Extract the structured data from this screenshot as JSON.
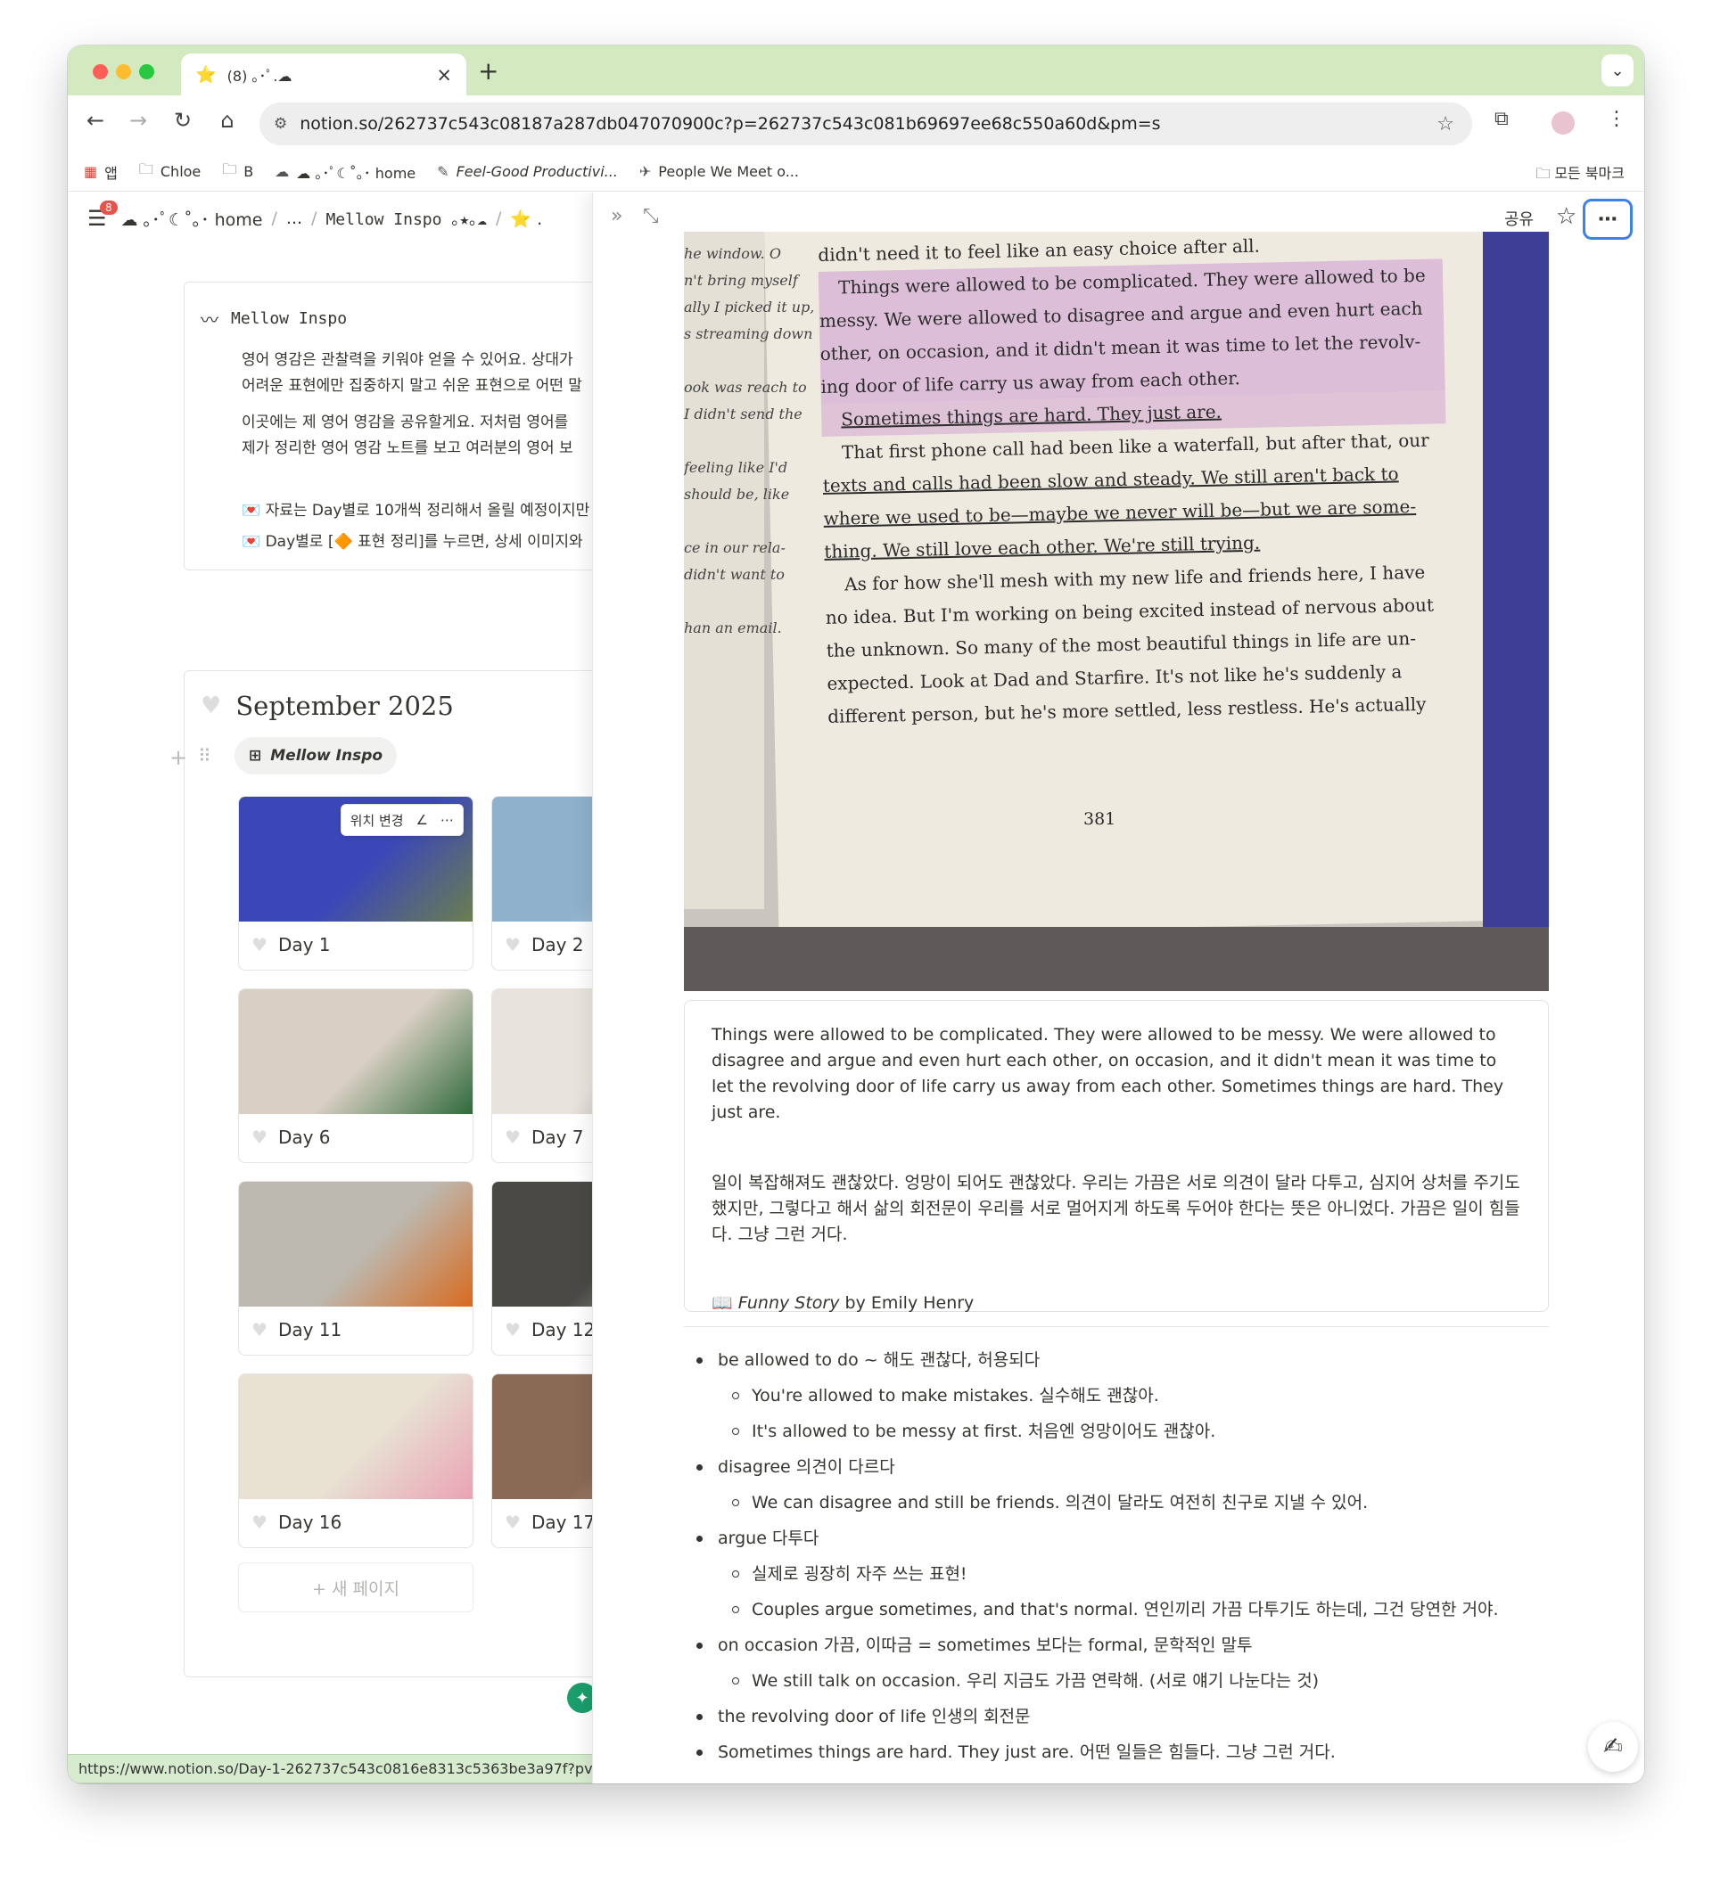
{
  "browser": {
    "tab": {
      "title": "(8) ｡･ﾟ.☁",
      "favicon": "⭐"
    },
    "url": "notion.so/262737c543c08187a287db047070900c?p=262737c543c081b69697ee68c550a60d&pm=s",
    "bookmarks": [
      {
        "icon": "apps-icon",
        "glyph": "▦",
        "label": "앱"
      },
      {
        "icon": "folder-icon",
        "glyph": "🗀",
        "label": "Chloe"
      },
      {
        "icon": "folder-icon",
        "glyph": "🗀",
        "label": "B"
      },
      {
        "icon": "cloud-icon",
        "glyph": "☁",
        "label": "☁ ｡･ﾟ☾˚｡･ home"
      },
      {
        "icon": "page-icon",
        "glyph": "✎",
        "label": "Feel-Good Productivi..."
      },
      {
        "icon": "plane-icon",
        "glyph": "✈",
        "label": "People We Meet o..."
      }
    ],
    "bookmarks_right": "모든 북마크",
    "status_url": "https://www.notion.so/Day-1-262737c543c0816e8313c5363be3a97f?pvs=25"
  },
  "notion": {
    "notification_count": "8",
    "breadcrumb": [
      "☁ ｡･ﾟ☾˚｡･ home",
      "...",
      "Mellow Inspo ｡★｡☁",
      "⭐ ."
    ],
    "callout": {
      "title": "Mellow Inspo",
      "p1_line1": "영어 영감은 관찰력을 키워야 얻을 수 있어요. 상대가",
      "p1_line2": "어려운 표현에만 집중하지 말고 쉬운 표현으로 어떤 말",
      "p2_line1": "이곳에는 제 영어 영감을 공유할게요. 저처럼 영어를",
      "p2_line2": "제가 정리한 영어 영감 노트를 보고 여러분의 영어 보",
      "bullet1": "💌 자료는 Day별로 10개씩 정리해서 올릴 예정이지만",
      "bullet2": "💌 Day별로 [🔶 표현 정리]를 누르면, 상세 이미지와"
    },
    "gallery": {
      "title": "September 2025",
      "view_label": "Mellow Inspo",
      "hover_tools_label": "위치 변경",
      "new_page": "+ 새 페이지",
      "cards": [
        {
          "label": "Day 1",
          "c1": "#3b47b8",
          "c2": "#6a7f4e"
        },
        {
          "label": "Day 2",
          "c1": "#8fb1cc",
          "c2": "#c9dbe8"
        },
        {
          "label": "Day 6",
          "c1": "#d9cfc3",
          "c2": "#2f6a3a"
        },
        {
          "label": "Day 7",
          "c1": "#e8e4dd",
          "c2": "#9a9590"
        },
        {
          "label": "Day 11",
          "c1": "#bdb9b0",
          "c2": "#d86a1f"
        },
        {
          "label": "Day 12",
          "c1": "#4a4946",
          "c2": "#e8e6e0"
        },
        {
          "label": "Day 16",
          "c1": "#e9e2d3",
          "c2": "#e9a3b5"
        },
        {
          "label": "Day 17",
          "c1": "#8a6a55",
          "c2": "#d9c3ad"
        }
      ]
    }
  },
  "peek": {
    "share_label": "공유",
    "photo": {
      "lines": [
        "didn't need it to feel like an easy choice after all.",
        "Things were allowed to be complicated. They were allowed to be",
        "messy. We were allowed to disagree and argue and even hurt each",
        "other, on occasion, and it didn't mean it was time to let the revolv-",
        "ing door of life carry us away from each other.",
        "Sometimes things are hard. They just are.",
        "That first phone call had been like a waterfall, but after that, our",
        "texts and calls had been slow and steady. We still aren't back to",
        "where we used to be—maybe we never will be—but we are some-",
        "thing. We still love each other. We're still trying.",
        "As for how she'll mesh with my new life and friends here, I have",
        "no idea. But I'm working on being excited instead of nervous about",
        "the unknown. So many of the most beautiful things in life are un-",
        "expected. Look at Dad and Starfire. It's not like he's suddenly a",
        "different person, but he's more settled, less restless. He's actually"
      ],
      "page_number": "381",
      "left_margin_lines": [
        "he window. O",
        "n't bring myself",
        "ally I picked it up,",
        "s streaming down",
        "",
        "ook was reach to",
        "I didn't send the",
        "",
        "feeling like I'd",
        "should be, like",
        "",
        "ce in our rela-",
        "didn't want to",
        "",
        "han an email."
      ]
    },
    "quote": {
      "english": "Things were allowed to be complicated. They were allowed to be messy. We were allowed to disagree and argue and even hurt each other, on occasion, and it didn't mean it was time to let the revolving door of life carry us away from each other. Sometimes things are hard. They just are.",
      "korean": "일이 복잡해져도 괜찮았다. 엉망이 되어도 괜찮았다. 우리는 가끔은 서로 의견이 달라 다투고, 심지어 상처를 주기도 했지만, 그렇다고 해서 삶의 회전문이 우리를 서로 멀어지게 하도록 두어야 한다는 뜻은 아니었다. 가끔은 일이 힘들다. 그냥 그런 거다.",
      "source_icon": "📖",
      "source_title": "Funny Story",
      "source_by": " by Emily Henry"
    },
    "notes": [
      {
        "level": 1,
        "text": "be allowed to do ~ 해도 괜찮다, 허용되다"
      },
      {
        "level": 2,
        "text": "You're allowed to make mistakes. 실수해도 괜찮아."
      },
      {
        "level": 2,
        "text": "It's allowed to be messy at first. 처음엔 엉망이어도 괜찮아."
      },
      {
        "level": 1,
        "text": "disagree 의견이 다르다"
      },
      {
        "level": 2,
        "text": "We can disagree and still be friends. 의견이 달라도 여전히 친구로 지낼 수 있어."
      },
      {
        "level": 1,
        "text": "argue 다투다"
      },
      {
        "level": 2,
        "text": "실제로 굉장히 자주 쓰는 표현!"
      },
      {
        "level": 2,
        "text": "Couples argue sometimes, and that's normal. 연인끼리 가끔 다투기도 하는데, 그건 당연한 거야."
      },
      {
        "level": 1,
        "text": "on occasion 가끔, 이따금 = sometimes 보다는 formal, 문학적인 말투"
      },
      {
        "level": 2,
        "text": "We still talk on occasion. 우리 지금도 가끔 연락해. (서로 얘기 나눈다는 것)"
      },
      {
        "level": 1,
        "text": "the revolving door of life 인생의 회전문"
      },
      {
        "level": 1,
        "text": "Sometimes things are hard. They just are. 어떤 일들은 힘들다. 그냥 그런 거다."
      }
    ]
  }
}
